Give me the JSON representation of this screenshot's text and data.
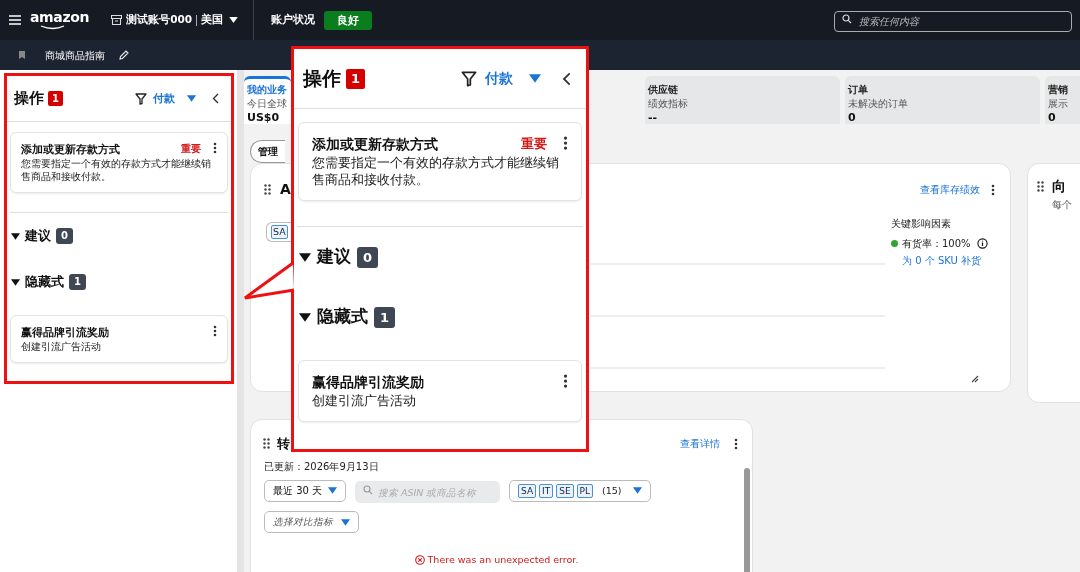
{
  "top_bar": {
    "logo": "amazon",
    "account": "测试账号000",
    "region": "美国",
    "status_label": "账户状况",
    "status": "良好",
    "search": {
      "placeholder": "搜索任何内容"
    }
  },
  "sub_bar": {
    "title": "商城商品指南"
  },
  "actions_panel": {
    "title": "操作",
    "count": "1",
    "filter": "付款",
    "items": [
      {
        "title": "添加或更新存款方式",
        "tag": "重要",
        "body": "您需要指定一个有效的存款方式才能继续销售商品和接收付款。"
      }
    ],
    "sections": [
      {
        "label": "建议",
        "count": "0",
        "expanded": true
      },
      {
        "label": "隐藏式",
        "count": "1",
        "expanded": true,
        "items": [
          {
            "title": "赢得品牌引流奖励",
            "body": "创建引流广告活动"
          }
        ]
      }
    ]
  },
  "tabs": [
    {
      "label": "我的业务",
      "caption": "今日全球",
      "value": "US$0",
      "selected": true
    },
    {
      "label": "供应链",
      "caption": "绩效指标",
      "value": "--",
      "selected": false
    },
    {
      "label": "订单",
      "caption": "未解决的订单",
      "value": "0",
      "selected": false
    },
    {
      "label": "营销",
      "caption": "展示",
      "value": "0",
      "selected": false
    }
  ],
  "manage_button": "管理",
  "inventory_card": {
    "title": "A",
    "tag": "SA",
    "link": "查看库存绩效",
    "factors_title": "关键影响因素",
    "factor": {
      "label": "有货率：100%",
      "color": "#2ea52e"
    },
    "factor_link": "为 0 个 SKU 补货"
  },
  "side_card": {
    "title": "向",
    "subtitle": "每个"
  },
  "conversion_card": {
    "title": "转",
    "link": "查看详情",
    "updated": "已更新：2026年9月13日",
    "range": "最近 30 天",
    "search": {
      "placeholder": "搜索 ASIN 或商品名称"
    },
    "tags": [
      "SA",
      "IT",
      "SE",
      "PL"
    ],
    "tag_count": "(15)",
    "compare": "选择对比指标",
    "error": "There was an unexpected error."
  },
  "callout": {
    "panel": {
      "title": "操作",
      "count": "1",
      "filter": "付款",
      "items": [
        {
          "title": "添加或更新存款方式",
          "tag": "重要",
          "body": "您需要指定一个有效的存款方式才能继续销售商品和接收付款。"
        }
      ],
      "sections": [
        {
          "label": "建议",
          "count": "0",
          "expanded": true
        },
        {
          "label": "隐藏式",
          "count": "1",
          "expanded": true,
          "items": [
            {
              "title": "赢得品牌引流奖励",
              "body": "创建引流广告活动"
            }
          ]
        }
      ]
    }
  }
}
